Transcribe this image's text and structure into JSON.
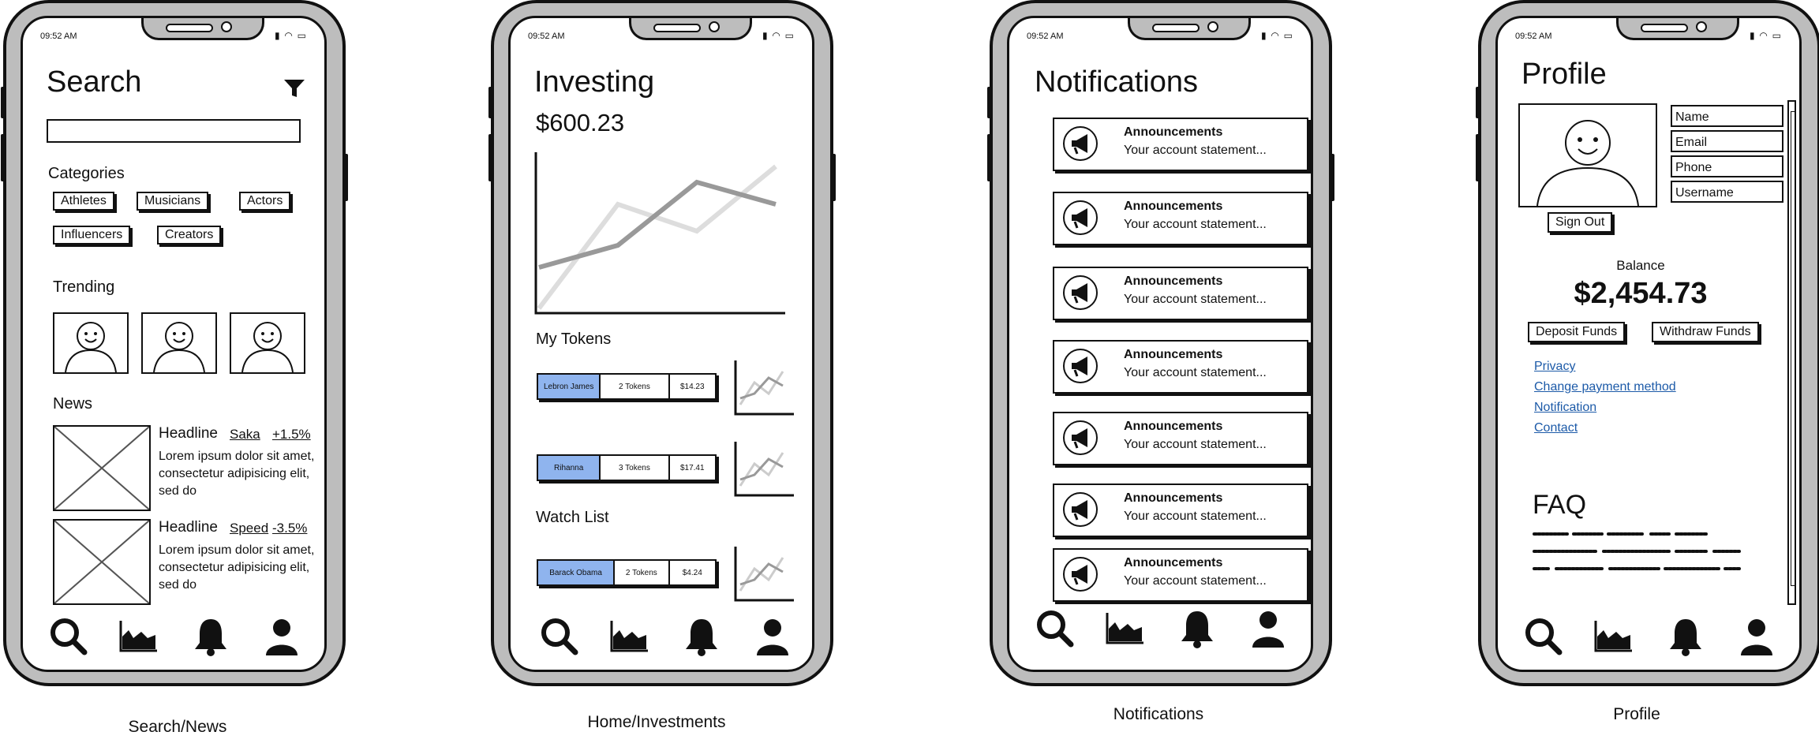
{
  "status": {
    "time": "09:52 AM"
  },
  "captions": [
    "Search/News",
    "Home/Investments",
    "Notifications",
    "Profile"
  ],
  "search": {
    "title": "Search",
    "search_placeholder": "",
    "categories_label": "Categories",
    "categories": [
      "Athletes",
      "Musicians",
      "Actors",
      "Influencers",
      "Creators"
    ],
    "trending_label": "Trending",
    "news_label": "News",
    "news": [
      {
        "headline": "Headline",
        "tag": "Saka",
        "change": "+1.5%",
        "body": "Lorem ipsum dolor sit amet, consectetur adipisicing elit, sed do"
      },
      {
        "headline": "Headline",
        "tag": "Speed",
        "change": "-3.5%",
        "body": "Lorem ipsum dolor sit amet, consectetur adipisicing elit, sed do"
      }
    ]
  },
  "investing": {
    "title": "Investing",
    "balance": "$600.23",
    "my_tokens_label": "My Tokens",
    "tokens": [
      {
        "name": "Lebron James",
        "amount": "2 Tokens",
        "value": "$14.23"
      },
      {
        "name": "Rihanna",
        "amount": "3 Tokens",
        "value": "$17.41"
      }
    ],
    "watch_list_label": "Watch List",
    "watch": [
      {
        "name": "Barack Obama",
        "amount": "2 Tokens",
        "value": "$4.24"
      }
    ]
  },
  "notifications": {
    "title": "Notifications",
    "items": [
      {
        "title": "Announcements",
        "text": "Your account statement..."
      },
      {
        "title": "Announcements",
        "text": "Your account statement..."
      },
      {
        "title": "Announcements",
        "text": "Your account statement..."
      },
      {
        "title": "Announcements",
        "text": "Your account statement..."
      },
      {
        "title": "Announcements",
        "text": "Your account statement..."
      },
      {
        "title": "Announcements",
        "text": "Your account statement..."
      },
      {
        "title": "Announcements",
        "text": "Your account statement..."
      }
    ]
  },
  "profile": {
    "title": "Profile",
    "fields": [
      "Name",
      "Email",
      "Phone",
      "Username"
    ],
    "sign_out": "Sign Out",
    "balance_label": "Balance",
    "balance": "$2,454.73",
    "deposit": "Deposit Funds",
    "withdraw": "Withdraw Funds",
    "links": [
      "Privacy",
      "Change payment method",
      "Notification",
      "Contact"
    ],
    "faq_title": "FAQ"
  },
  "nav_icons": [
    "search-icon",
    "chart-icon",
    "bell-icon",
    "user-icon"
  ],
  "colors": {
    "token_highlight": "#8fb4ee",
    "link": "#1c5aa8",
    "bezel": "#bdbdbd"
  }
}
